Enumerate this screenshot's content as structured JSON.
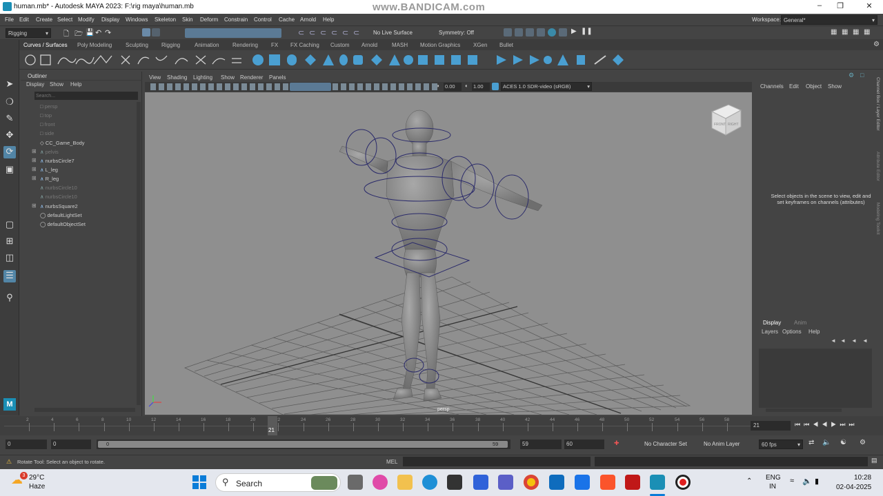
{
  "window": {
    "title": "human.mb* - Autodesk MAYA 2023: F:\\rig maya\\human.mb",
    "watermark": "www.BANDICAM.com",
    "workspace_label": "Workspace:",
    "workspace_value": "General*"
  },
  "menu": [
    "File",
    "Edit",
    "Create",
    "Select",
    "Modify",
    "Display",
    "Windows",
    "Skeleton",
    "Skin",
    "Deform",
    "Constrain",
    "Control",
    "Cache",
    "Arnold",
    "Help"
  ],
  "statusline": {
    "menuset": "Rigging",
    "live_surface": "No Live Surface",
    "symmetry": "Symmetry: Off"
  },
  "shelf_tabs": [
    "Curves / Surfaces",
    "Poly Modeling",
    "Sculpting",
    "Rigging",
    "Animation",
    "Rendering",
    "FX",
    "FX Caching",
    "Custom",
    "Arnold",
    "MASH",
    "Motion Graphics",
    "XGen",
    "Bullet"
  ],
  "outliner": {
    "title": "Outliner",
    "menu": [
      "Display",
      "Show",
      "Help"
    ],
    "search_placeholder": "Search...",
    "items": [
      {
        "label": "persp",
        "dim": true
      },
      {
        "label": "top",
        "dim": true
      },
      {
        "label": "front",
        "dim": true
      },
      {
        "label": "side",
        "dim": true
      },
      {
        "label": "CC_Game_Body",
        "dim": false
      },
      {
        "label": "pelvis",
        "dim": true
      },
      {
        "label": "nurbsCircle7",
        "dim": false
      },
      {
        "label": "L_leg",
        "dim": false
      },
      {
        "label": "R_leg",
        "dim": false
      },
      {
        "label": "nurbsCircle10",
        "dim": true
      },
      {
        "label": "nurbsCircle10",
        "dim": true
      },
      {
        "label": "nurbsSquare2",
        "dim": false
      },
      {
        "label": "defaultLightSet",
        "dim": false
      },
      {
        "label": "defaultObjectSet",
        "dim": false
      }
    ]
  },
  "viewport": {
    "menu": [
      "View",
      "Shading",
      "Lighting",
      "Show",
      "Renderer",
      "Panels"
    ],
    "exposure": "0.00",
    "gamma": "1.00",
    "colorspace": "ACES 1.0 SDR-video (sRGB)",
    "camera_label": "persp",
    "viewcube_front": "FRONT",
    "viewcube_right": "RIGHT"
  },
  "channelbox": {
    "menu": [
      "Channels",
      "Edit",
      "Object",
      "Show"
    ],
    "message": "Select objects in the scene to view, edit and set keyframes on channels (attributes)",
    "side_tabs": [
      "Channel Box / Layer Editor",
      "Attribute Editor",
      "Modeling Toolkit"
    ]
  },
  "layers": {
    "tabs": [
      "Display",
      "Anim"
    ],
    "menu": [
      "Layers",
      "Options",
      "Help"
    ]
  },
  "timeline": {
    "ticks": [
      "2",
      "4",
      "6",
      "8",
      "10",
      "12",
      "14",
      "16",
      "18",
      "20",
      "22",
      "24",
      "26",
      "28",
      "30",
      "32",
      "34",
      "36",
      "38",
      "40",
      "42",
      "44",
      "46",
      "48",
      "50",
      "52",
      "54",
      "56",
      "58"
    ],
    "current_frame_marker": "21",
    "current_frame_field": "21"
  },
  "range": {
    "start": "0",
    "anim_start": "0",
    "slider_start": "0",
    "slider_end": "59",
    "anim_end": "59",
    "end": "60",
    "character_set": "No Character Set",
    "anim_layer": "No Anim Layer",
    "fps": "60 fps"
  },
  "helpline": {
    "text": "Rotate Tool: Select an object to rotate.",
    "mel": "MEL"
  },
  "taskbar": {
    "weather_temp": "29°C",
    "weather_desc": "Haze",
    "weather_badge": "3",
    "search": "Search",
    "lang1": "ENG",
    "lang2": "IN",
    "time": "10:28",
    "date": "02-04-2025"
  }
}
